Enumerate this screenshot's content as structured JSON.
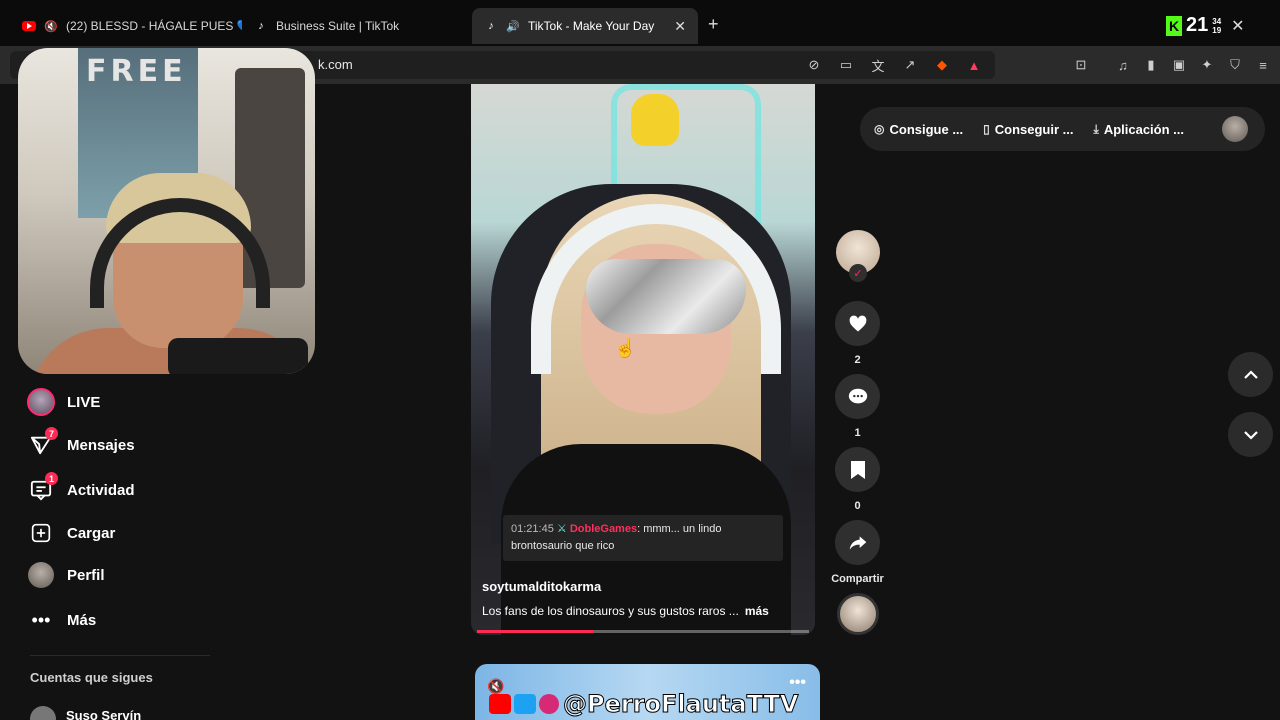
{
  "browser": {
    "tabs": [
      {
        "label": "(22) BLESSD - HÁGALE PUES 💙✌"
      },
      {
        "label": "Business Suite | TikTok"
      },
      {
        "label": "TikTok - Make Your Day"
      }
    ],
    "new_tab": "+",
    "url": "k.com",
    "kick_count": "21",
    "kick_mini_top": "34",
    "kick_mini_bottom": "19"
  },
  "icons": {
    "youtube": "youtube-icon",
    "mute": "muted-speaker-icon",
    "tiktok": "tiktok-icon"
  },
  "nav": {
    "live": "LIVE",
    "messages": "Mensajes",
    "messages_badge": "7",
    "activity": "Actividad",
    "activity_badge": "1",
    "upload": "Cargar",
    "profile": "Perfil",
    "more": "Más",
    "following_title": "Cuentas que sigues",
    "following": [
      {
        "name": "Suso Servín"
      }
    ]
  },
  "webcam": {
    "poster_text": "FREE"
  },
  "video": {
    "chat_time": "01:21:45",
    "chat_user": "DobleGames",
    "chat_msg1": ": mmm... un lindo",
    "chat_msg2": "brontosaurio que rico",
    "author": "soytumalditokarma",
    "description": "Los fans de los dinosauros y sus gustos raros ...",
    "more": "más",
    "progress": 0.35
  },
  "actions": {
    "likes": "2",
    "comments": "1",
    "saves": "0",
    "share_label": "Compartir"
  },
  "topbar": {
    "coins": "Consigue ...",
    "get_app": "Conseguir ...",
    "app": "Aplicación ..."
  },
  "next_video": {
    "handle": "@PerroFlautaTTV"
  },
  "colors": {
    "accent": "#fe2c55",
    "background": "#121212",
    "kick_green": "#53fc18"
  }
}
